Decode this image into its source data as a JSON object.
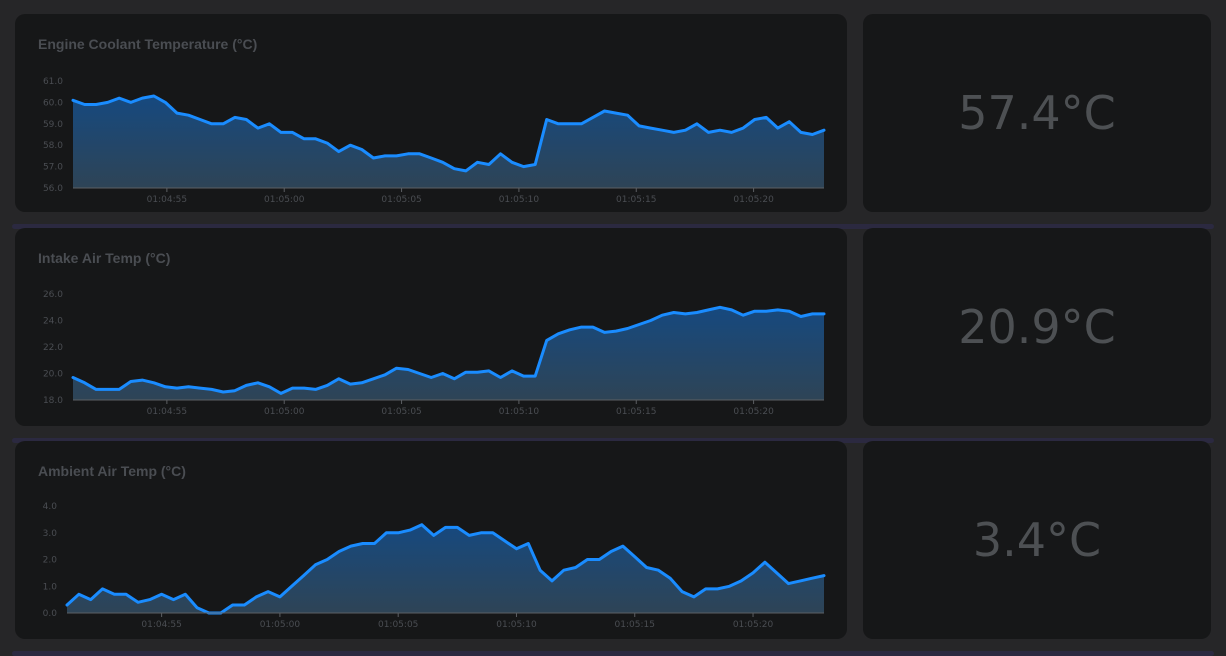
{
  "chart_data": [
    {
      "type": "area",
      "title": "Engine Coolant Temperature (°C)",
      "xlabel": "",
      "ylabel": "",
      "ylim": [
        56.0,
        61.0
      ],
      "y_ticks": [
        "56.0",
        "57.0",
        "58.0",
        "59.0",
        "60.0",
        "61.0"
      ],
      "x_ticks": [
        "01:04:55",
        "01:05:00",
        "01:05:05",
        "01:05:10",
        "01:05:15",
        "01:05:20"
      ],
      "x_start": "01:04:51",
      "x_end": "01:05:23",
      "values": [
        60.1,
        59.9,
        59.9,
        60.0,
        60.2,
        60.0,
        60.2,
        60.3,
        60.0,
        59.5,
        59.4,
        59.2,
        59.0,
        59.0,
        59.3,
        59.2,
        58.8,
        59.0,
        58.6,
        58.6,
        58.3,
        58.3,
        58.1,
        57.7,
        58.0,
        57.8,
        57.4,
        57.5,
        57.5,
        57.6,
        57.6,
        57.4,
        57.2,
        56.9,
        56.8,
        57.2,
        57.1,
        57.6,
        57.2,
        57.0,
        57.1,
        59.2,
        59.0,
        59.0,
        59.0,
        59.3,
        59.6,
        59.5,
        59.4,
        58.9,
        58.8,
        58.7,
        58.6,
        58.7,
        59.0,
        58.6,
        58.7,
        58.6,
        58.8,
        59.2,
        59.3,
        58.8,
        59.1,
        58.6,
        58.5,
        58.7
      ],
      "current": "57.4°C",
      "line_color": "#1a8cff",
      "fill_top": "#16497f",
      "fill_bottom": "#2e4456"
    },
    {
      "type": "area",
      "title": "Intake Air Temp (°C)",
      "xlabel": "",
      "ylabel": "",
      "ylim": [
        18.0,
        26.0
      ],
      "y_ticks": [
        "18.0",
        "20.0",
        "22.0",
        "24.0",
        "26.0"
      ],
      "x_ticks": [
        "01:04:55",
        "01:05:00",
        "01:05:05",
        "01:05:10",
        "01:05:15",
        "01:05:20"
      ],
      "x_start": "01:04:51",
      "x_end": "01:05:23",
      "values": [
        19.7,
        19.3,
        18.8,
        18.8,
        18.8,
        19.4,
        19.5,
        19.3,
        19.0,
        18.9,
        19.0,
        18.9,
        18.8,
        18.6,
        18.7,
        19.1,
        19.3,
        19.0,
        18.5,
        18.9,
        18.9,
        18.8,
        19.1,
        19.6,
        19.2,
        19.3,
        19.6,
        19.9,
        20.4,
        20.3,
        20.0,
        19.7,
        20.0,
        19.6,
        20.1,
        20.1,
        20.2,
        19.7,
        20.2,
        19.8,
        19.8,
        22.5,
        23.0,
        23.3,
        23.5,
        23.5,
        23.1,
        23.2,
        23.4,
        23.7,
        24.0,
        24.4,
        24.6,
        24.5,
        24.6,
        24.8,
        25.0,
        24.8,
        24.4,
        24.7,
        24.7,
        24.8,
        24.7,
        24.3,
        24.5,
        24.5
      ],
      "current": "20.9°C",
      "line_color": "#1a8cff",
      "fill_top": "#16497f",
      "fill_bottom": "#2e4456"
    },
    {
      "type": "area",
      "title": "Ambient Air Temp (°C)",
      "xlabel": "",
      "ylabel": "",
      "ylim": [
        0.0,
        4.0
      ],
      "y_ticks": [
        "0.0",
        "1.0",
        "2.0",
        "3.0",
        "4.0"
      ],
      "x_ticks": [
        "01:04:55",
        "01:05:00",
        "01:05:05",
        "01:05:10",
        "01:05:15",
        "01:05:20"
      ],
      "x_start": "01:04:51",
      "x_end": "01:05:23",
      "values": [
        0.3,
        0.7,
        0.5,
        0.9,
        0.7,
        0.7,
        0.4,
        0.5,
        0.7,
        0.5,
        0.7,
        0.2,
        0.0,
        0.0,
        0.3,
        0.3,
        0.6,
        0.8,
        0.6,
        1.0,
        1.4,
        1.8,
        2.0,
        2.3,
        2.5,
        2.6,
        2.6,
        3.0,
        3.0,
        3.1,
        3.3,
        2.9,
        3.2,
        3.2,
        2.9,
        3.0,
        3.0,
        2.7,
        2.4,
        2.6,
        1.6,
        1.2,
        1.6,
        1.7,
        2.0,
        2.0,
        2.3,
        2.5,
        2.1,
        1.7,
        1.6,
        1.3,
        0.8,
        0.6,
        0.9,
        0.9,
        1.0,
        1.2,
        1.5,
        1.9,
        1.5,
        1.1,
        1.2,
        1.3,
        1.4
      ],
      "current": "3.4°C",
      "line_color": "#1a8cff",
      "fill_top": "#16497f",
      "fill_bottom": "#2e4456"
    }
  ]
}
